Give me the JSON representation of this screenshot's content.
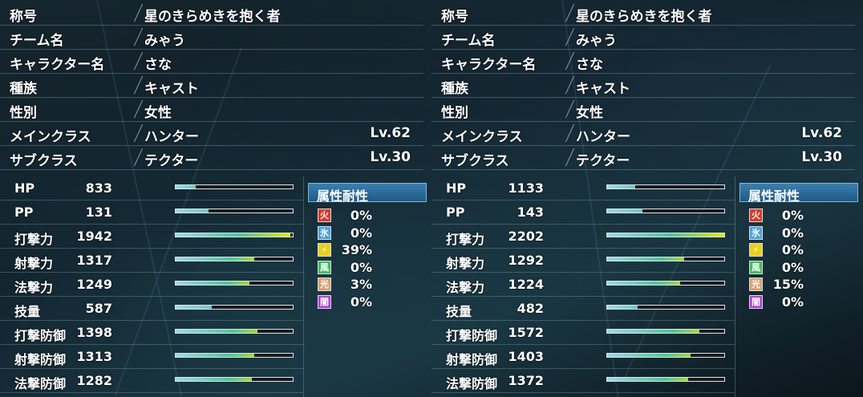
{
  "panels": [
    {
      "info": [
        {
          "label": "称号",
          "value": "星のきらめきを抱く者",
          "level": ""
        },
        {
          "label": "チーム名",
          "value": "みゃう",
          "level": ""
        },
        {
          "label": "キャラクター名",
          "value": "さな",
          "level": ""
        },
        {
          "label": "種族",
          "value": "キャスト",
          "level": ""
        },
        {
          "label": "性別",
          "value": "女性",
          "level": ""
        },
        {
          "label": "メインクラス",
          "value": "ハンター",
          "level": "Lv.62"
        },
        {
          "label": "サブクラス",
          "value": "テクター",
          "level": "Lv.30"
        }
      ],
      "stats": [
        {
          "label": "HP",
          "value": "833",
          "fill": 0.17
        },
        {
          "label": "PP",
          "value": "131",
          "fill": 0.28
        },
        {
          "label": "打撃力",
          "value": "1942",
          "fill": 0.98
        },
        {
          "label": "射撃力",
          "value": "1317",
          "fill": 0.67
        },
        {
          "label": "法撃力",
          "value": "1249",
          "fill": 0.63
        },
        {
          "label": "技量",
          "value": "587",
          "fill": 0.31
        },
        {
          "label": "打撃防御",
          "value": "1398",
          "fill": 0.7
        },
        {
          "label": "射撃防御",
          "value": "1313",
          "fill": 0.67
        },
        {
          "label": "法撃防御",
          "value": "1282",
          "fill": 0.65
        }
      ],
      "resist_title": "属性耐性",
      "resist": [
        {
          "icon": "fire-icon",
          "value": "0%"
        },
        {
          "icon": "ice-icon",
          "value": "0%"
        },
        {
          "icon": "lightning-icon",
          "value": "39%"
        },
        {
          "icon": "wind-icon",
          "value": "0%"
        },
        {
          "icon": "light-icon",
          "value": "3%"
        },
        {
          "icon": "dark-icon",
          "value": "0%"
        }
      ]
    },
    {
      "info": [
        {
          "label": "称号",
          "value": "星のきらめきを抱く者",
          "level": ""
        },
        {
          "label": "チーム名",
          "value": "みゃう",
          "level": ""
        },
        {
          "label": "キャラクター名",
          "value": "さな",
          "level": ""
        },
        {
          "label": "種族",
          "value": "キャスト",
          "level": ""
        },
        {
          "label": "性別",
          "value": "女性",
          "level": ""
        },
        {
          "label": "メインクラス",
          "value": "ハンター",
          "level": "Lv.62"
        },
        {
          "label": "サブクラス",
          "value": "テクター",
          "level": "Lv.30"
        }
      ],
      "stats": [
        {
          "label": "HP",
          "value": "1133",
          "fill": 0.24
        },
        {
          "label": "PP",
          "value": "143",
          "fill": 0.3
        },
        {
          "label": "打撃力",
          "value": "2202",
          "fill": 1.0
        },
        {
          "label": "射撃力",
          "value": "1292",
          "fill": 0.66
        },
        {
          "label": "法撃力",
          "value": "1224",
          "fill": 0.62
        },
        {
          "label": "技量",
          "value": "482",
          "fill": 0.26
        },
        {
          "label": "打撃防御",
          "value": "1572",
          "fill": 0.79
        },
        {
          "label": "射撃防御",
          "value": "1403",
          "fill": 0.71
        },
        {
          "label": "法撃防御",
          "value": "1372",
          "fill": 0.69
        }
      ],
      "resist_title": "属性耐性",
      "resist": [
        {
          "icon": "fire-icon",
          "value": "0%"
        },
        {
          "icon": "ice-icon",
          "value": "0%"
        },
        {
          "icon": "lightning-icon",
          "value": "0%"
        },
        {
          "icon": "wind-icon",
          "value": "0%"
        },
        {
          "icon": "light-icon",
          "value": "15%"
        },
        {
          "icon": "dark-icon",
          "value": "0%"
        }
      ]
    }
  ],
  "colors": {
    "bar_low": "#9fd8e4",
    "bar_mid": "#49c89a",
    "bar_high": "#e8e800",
    "icon_fire": "#d83a2a",
    "icon_ice": "#4aa4d8",
    "icon_lightning": "#e8d020",
    "icon_wind": "#3fbf5a",
    "icon_light": "#d8a070",
    "icon_dark": "#b040d0"
  }
}
